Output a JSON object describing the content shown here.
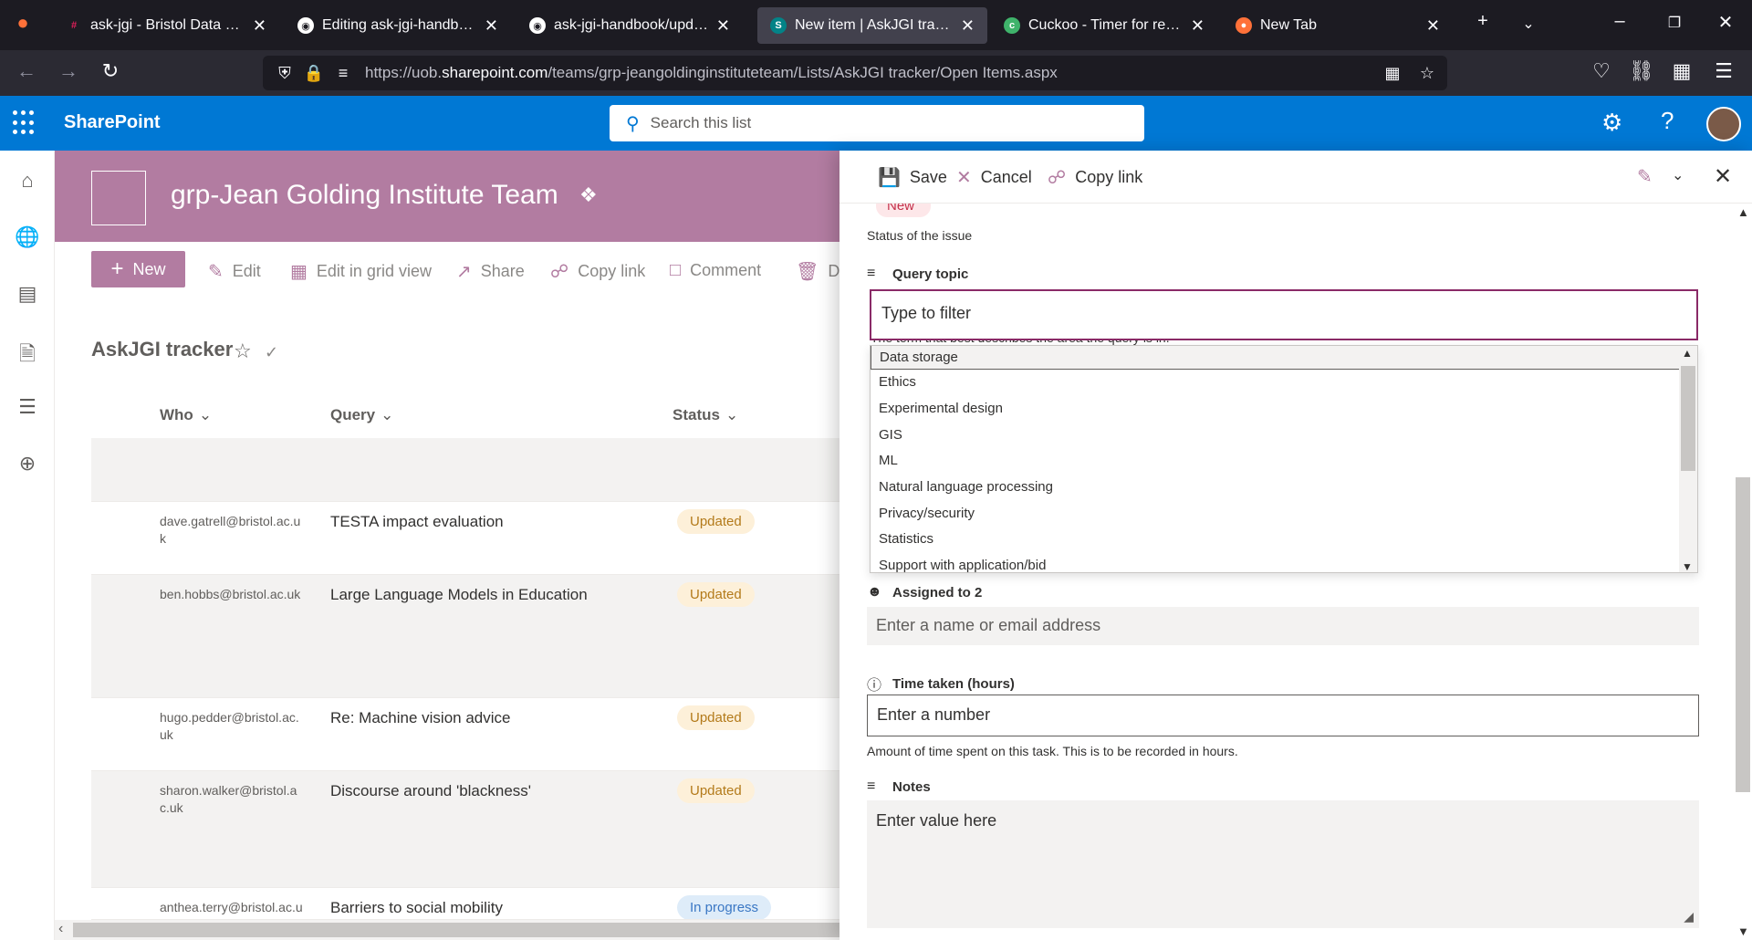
{
  "browser": {
    "tabs": [
      {
        "title": "ask-jgi - Bristol Data Science",
        "favicon": "slack-icon",
        "favicon_color": "#e01e5a"
      },
      {
        "title": "Editing ask-jgi-handbook/u",
        "favicon": "github-icon",
        "favicon_color": "#ffffff"
      },
      {
        "title": "ask-jgi-handbook/update-t",
        "favicon": "github-icon",
        "favicon_color": "#ffffff"
      },
      {
        "title": "New item | AskJGI tracker",
        "favicon": "sharepoint-icon",
        "favicon_color": "#038387"
      },
      {
        "title": "Cuckoo - Timer for remote t",
        "favicon": "cuckoo-icon",
        "favicon_color": "#3fb36b"
      },
      {
        "title": "New Tab",
        "favicon": "firefox-icon",
        "favicon_color": "#ff7139"
      }
    ],
    "url_prefix": "https://uob.",
    "url_domain": "sharepoint.com",
    "url_path": "/teams/grp-jeangoldinginstituteteam/Lists/AskJGI tracker/Open Items.aspx"
  },
  "suite": {
    "brand": "SharePoint",
    "search_placeholder": "Search this list",
    "accent": "#0078d4"
  },
  "site": {
    "title": "grp-Jean Golding Institute Team",
    "theme": "#b27ca1"
  },
  "commands": {
    "new": "New",
    "edit": "Edit",
    "grid": "Edit in grid view",
    "share": "Share",
    "copy_link": "Copy link",
    "comment": "Comment",
    "delete": "De"
  },
  "list": {
    "title": "AskJGI tracker",
    "columns": {
      "who": "Who",
      "query": "Query",
      "status": "Status"
    },
    "rows": [
      {
        "who": "dave.gatrell@bristol.ac.uk",
        "query": "TESTA impact evaluation",
        "status": "Updated"
      },
      {
        "who": "ben.hobbs@bristol.ac.uk",
        "query": "Large Language Models in Education",
        "status": "Updated"
      },
      {
        "who": "hugo.pedder@bristol.ac.uk",
        "query": "Re: Machine vision advice",
        "status": "Updated"
      },
      {
        "who": "sharon.walker@bristol.ac.uk",
        "query": "Discourse around 'blackness'",
        "status": "Updated"
      },
      {
        "who": "anthea.terry@bristol.ac.uk",
        "query": "Barriers to social mobility",
        "status": "In progress"
      }
    ]
  },
  "panel": {
    "save": "Save",
    "cancel": "Cancel",
    "copy_link": "Copy link",
    "status_badge": "New",
    "status_help": "Status of the issue",
    "query_topic_label": "Query topic",
    "filter_placeholder": "Type to filter",
    "query_topic_help": "The term that best describes the area the query is in.",
    "topic_options": [
      "Data storage",
      "Ethics",
      "Experimental design",
      "GIS",
      "ML",
      "Natural language processing",
      "Privacy/security",
      "Statistics",
      "Support with application/bid"
    ],
    "assigned2_label": "Assigned to 2",
    "assigned2_placeholder": "Enter a name or email address",
    "time_label": "Time taken (hours)",
    "time_placeholder": "Enter a number",
    "time_help": "Amount of time spent on this task. This is to be recorded in hours.",
    "notes_label": "Notes",
    "notes_placeholder": "Enter value here"
  }
}
